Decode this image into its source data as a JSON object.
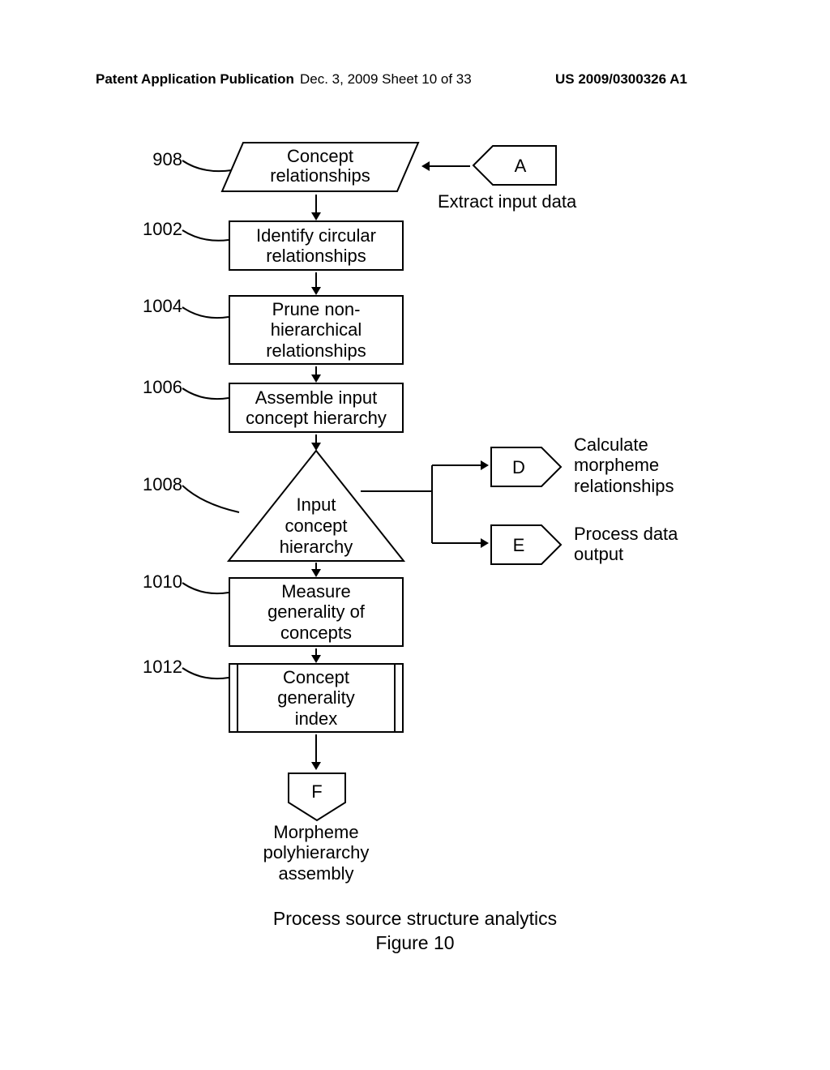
{
  "header": {
    "left": "Patent Application Publication",
    "mid": "Dec. 3, 2009  Sheet 10 of 33",
    "right": "US 2009/0300326 A1"
  },
  "refs": {
    "r908": "908",
    "r1002": "1002",
    "r1004": "1004",
    "r1006": "1006",
    "r1008": "1008",
    "r1010": "1010",
    "r1012": "1012"
  },
  "nodes": {
    "concept_relationships": "Concept\nrelationships",
    "identify_circular": "Identify circular\nrelationships",
    "prune_nonhier": "Prune non-\nhierarchical\nrelationships",
    "assemble_hierarchy": "Assemble input\nconcept hierarchy",
    "input_hierarchy": "Input\nconcept\nhierarchy",
    "measure_generality": "Measure\ngenerality of\nconcepts",
    "concept_generality_index": "Concept\ngenerality\nindex",
    "connA": "A",
    "connD": "D",
    "connE": "E",
    "connF": "F"
  },
  "annotations": {
    "extract_input_data": "Extract input data",
    "calc_morpheme": "Calculate\nmorpheme\nrelationships",
    "process_data_output": "Process data\noutput",
    "morpheme_polyhierarchy_assembly": "Morpheme\npolyhierarchy\nassembly"
  },
  "caption": "Process source structure analytics",
  "figure_label": "Figure 10"
}
